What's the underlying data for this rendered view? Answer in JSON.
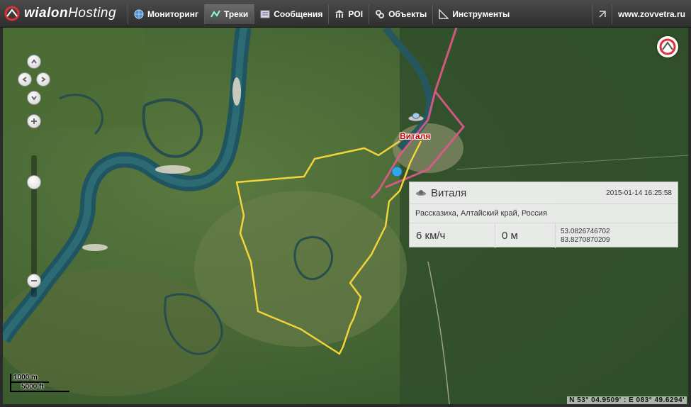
{
  "app": {
    "logo_primary": "wialon",
    "logo_secondary": "Hosting"
  },
  "nav": [
    {
      "label": "Мониторинг",
      "icon": "globe-icon"
    },
    {
      "label": "Треки",
      "icon": "track-icon",
      "active": true
    },
    {
      "label": "Сообщения",
      "icon": "messages-icon"
    },
    {
      "label": "POI",
      "icon": "poi-icon"
    },
    {
      "label": "Объекты",
      "icon": "objects-icon"
    },
    {
      "label": "Инструменты",
      "icon": "tools-icon"
    }
  ],
  "header_right": {
    "site": "www.zovvetra.ru",
    "expand_icon": "expand-icon"
  },
  "map": {
    "unit_label": "Виталя",
    "scale_metric": "1000 m",
    "scale_imperial": "5000 ft",
    "cursor_readout": "N 53° 04.9509' : E 083° 49.6294'",
    "colors": {
      "track": "#f2d43a",
      "track_other": "#e05a8a",
      "label": "#c40000"
    }
  },
  "popup": {
    "unit_name": "Виталя",
    "timestamp": "2015-01-14 16:25:58",
    "address": "Рассказиха, Алтайский край, Россия",
    "speed": "6 км/ч",
    "altitude": "0 м",
    "latitude": "53.0826746702",
    "longitude": "83.8270870209"
  }
}
